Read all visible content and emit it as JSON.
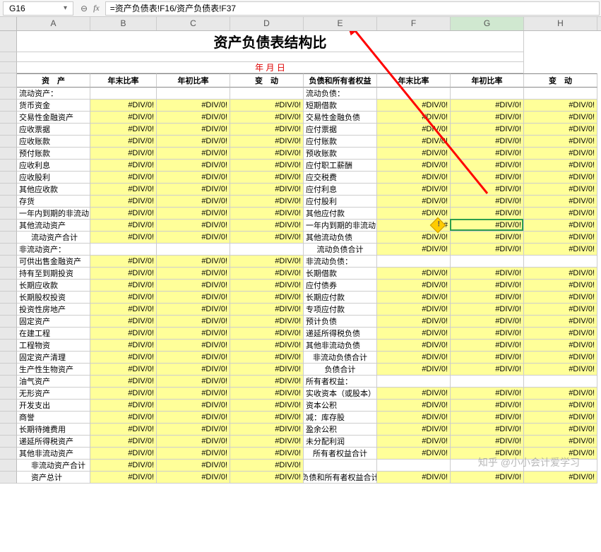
{
  "formulaBar": {
    "cellRef": "G16",
    "formula": "=资产负债表!F16/资产负债表!F37"
  },
  "colHeaders": [
    "A",
    "B",
    "C",
    "D",
    "E",
    "F",
    "G",
    "H"
  ],
  "title": "资产负债表结构比",
  "dateLabel": "年  月  日",
  "tableHeaders": [
    "资　产",
    "年末比率",
    "年初比率",
    "变　动",
    "负债和所有者权益",
    "年末比率",
    "年初比率",
    "变　动"
  ],
  "err": "#DIV/0!",
  "errShort": "#",
  "watermark": "知乎 @小小会计爱学习",
  "rows": [
    {
      "l": "流动资产：",
      "lt": "s",
      "r": "流动负债："
    },
    {
      "l": "货币资金",
      "ly": 1,
      "r": "短期借款",
      "ry": 1
    },
    {
      "l": "交易性金融资产",
      "ly": 1,
      "r": "交易性金融负债",
      "ry": 1
    },
    {
      "l": "应收票据",
      "ly": 1,
      "r": "应付票据",
      "ry": 1
    },
    {
      "l": "应收账款",
      "ly": 1,
      "r": "应付账款",
      "ry": 1
    },
    {
      "l": "预付账款",
      "ly": 1,
      "r": "预收账款",
      "ry": 1
    },
    {
      "l": "应收利息",
      "ly": 1,
      "r": "应付职工薪酬",
      "ry": 1
    },
    {
      "l": "应收股利",
      "ly": 1,
      "r": "应交税费",
      "ry": 1
    },
    {
      "l": "其他应收款",
      "ly": 1,
      "r": "应付利息",
      "ry": 1
    },
    {
      "l": "存货",
      "ly": 1,
      "r": "应付股利",
      "ry": 1
    },
    {
      "l": "一年内到期的非流动",
      "ly": 1,
      "r": "其他应付款",
      "ry": 1
    },
    {
      "l": "其他流动资产",
      "ly": 1,
      "r": "一年内到期的非流动负",
      "ry": 1,
      "active": 1
    },
    {
      "l": "流动资产合计",
      "li": 1,
      "lsy": 1,
      "r": "其他流动负债",
      "ry": 1
    },
    {
      "l": "非流动资产：",
      "lt": "s",
      "r": "流动负债合计",
      "rc": 1,
      "rsy": 1
    },
    {
      "l": "可供出售金融资产",
      "ly": 1,
      "r": "非流动负债："
    },
    {
      "l": "持有至到期投资",
      "ly": 1,
      "r": "长期借款",
      "ry": 1
    },
    {
      "l": "长期应收款",
      "ly": 1,
      "r": "应付债券",
      "ry": 1
    },
    {
      "l": "长期股权投资",
      "ly": 1,
      "r": "长期应付款",
      "ry": 1
    },
    {
      "l": "投资性房地产",
      "ly": 1,
      "r": "专项应付款",
      "ry": 1
    },
    {
      "l": "固定资产",
      "ly": 1,
      "r": "预计负债",
      "ry": 1
    },
    {
      "l": "在建工程",
      "ly": 1,
      "r": "递延所得税负债",
      "ry": 1
    },
    {
      "l": "工程物资",
      "ly": 1,
      "r": "其他非流动负债",
      "ry": 1
    },
    {
      "l": "固定资产清理",
      "ly": 1,
      "r": "非流动负债合计",
      "rc": 1,
      "rsy": 1
    },
    {
      "l": "生产性生物资产",
      "ly": 1,
      "r": "负债合计",
      "rc": 1,
      "rsy": 1
    },
    {
      "l": "油气资产",
      "ly": 1,
      "r": "所有者权益："
    },
    {
      "l": "无形资产",
      "ly": 1,
      "r": "实收资本（或股本）",
      "ry": 1
    },
    {
      "l": "开发支出",
      "ly": 1,
      "r": "资本公积",
      "ry": 1
    },
    {
      "l": "商誉",
      "ly": 1,
      "r": "减：库存股",
      "ry": 1
    },
    {
      "l": "长期待摊费用",
      "ly": 1,
      "r": "盈余公积",
      "ry": 1
    },
    {
      "l": "递延所得税资产",
      "ly": 1,
      "r": "未分配利润",
      "ry": 1
    },
    {
      "l": "其他非流动资产",
      "ly": 1,
      "r": "所有者权益合计",
      "rc": 1,
      "rsy": 1
    },
    {
      "l": "非流动资产合计",
      "li": 1,
      "lsy": 1,
      "r": ""
    },
    {
      "l": "资产总计",
      "li": 1,
      "lsy": 1,
      "r": "负债和所有者权益合计",
      "rc": 1,
      "rsy": 1
    }
  ]
}
